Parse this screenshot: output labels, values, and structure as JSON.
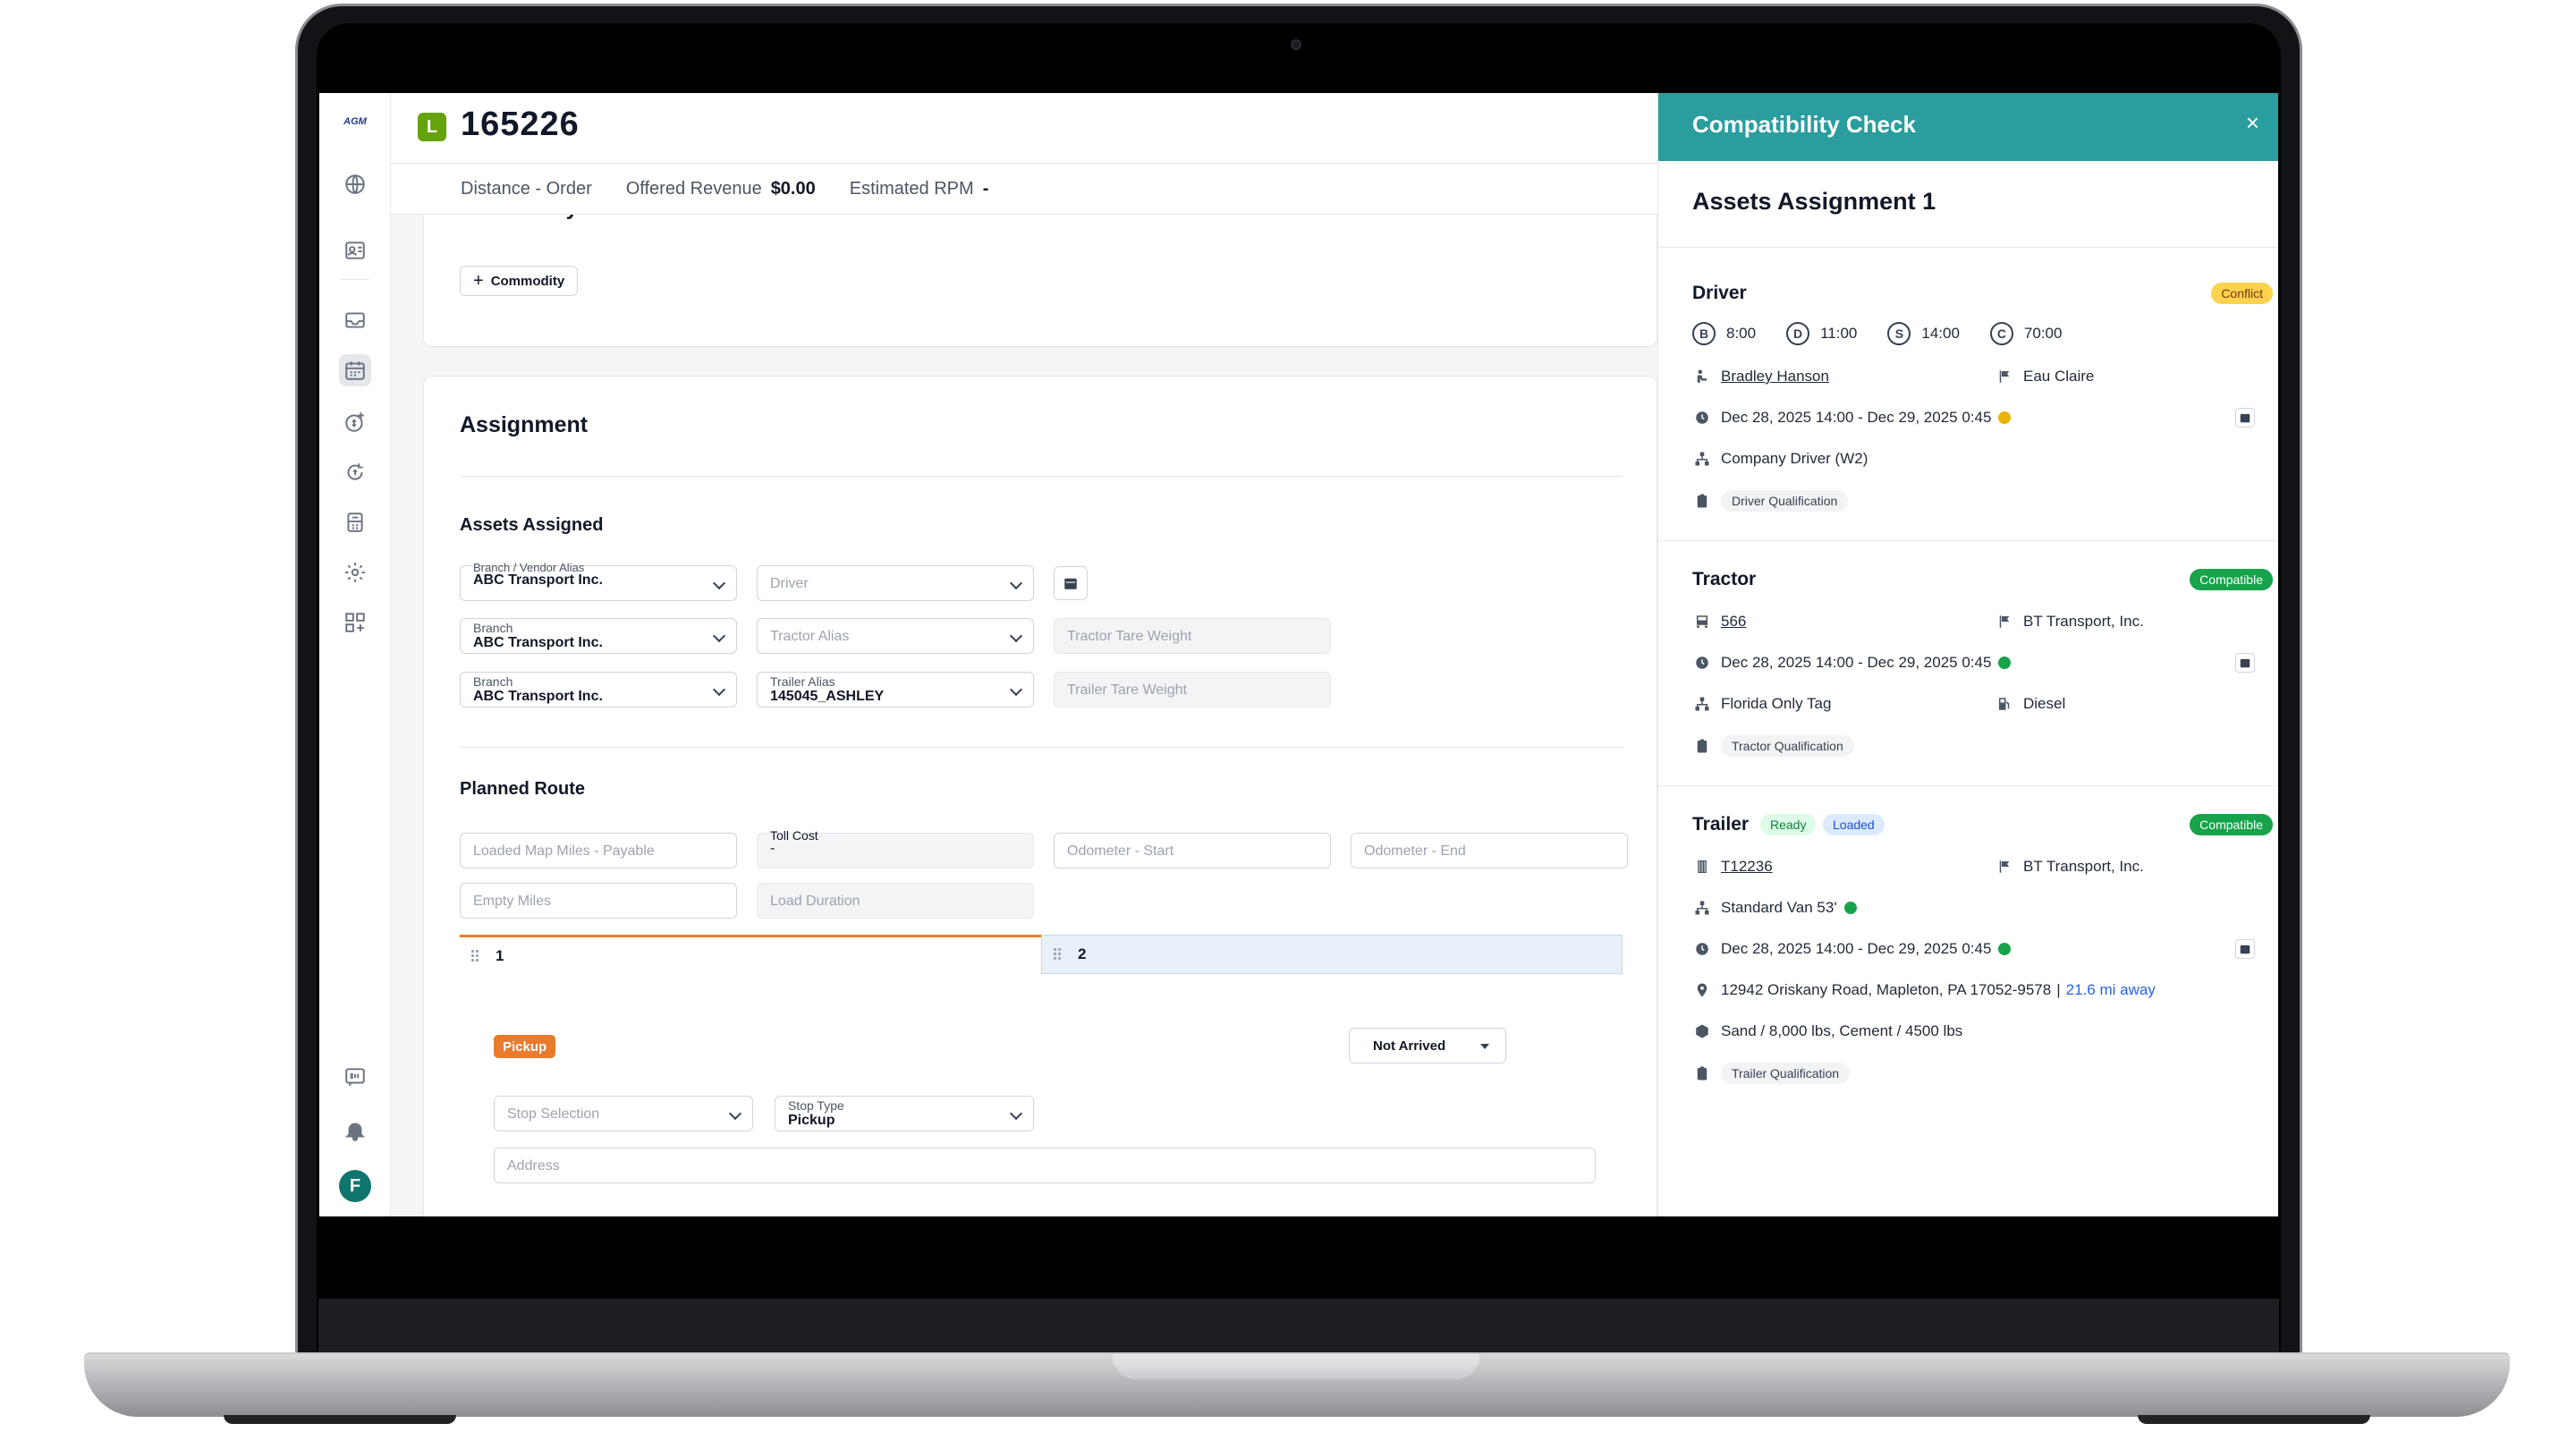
{
  "header": {
    "badge": "L",
    "load_number": "165226",
    "distance_label": "Distance",
    "distance_value": "-",
    "distance_mode": "Order",
    "offered_revenue_label": "Offered Revenue",
    "offered_revenue_value": "$0.00",
    "estimated_rpm_label": "Estimated RPM",
    "estimated_rpm_value": "-"
  },
  "sidebar": {
    "logo": "AGM",
    "avatar": "F",
    "items": [
      "globe-icon",
      "contacts-icon",
      "inbox-icon",
      "calendar-icon",
      "dollar-plus-icon",
      "dollar-refresh-icon",
      "calculator-icon",
      "gear-icon",
      "grid-plus-icon",
      "edi-icon",
      "bell-icon"
    ]
  },
  "commodity": {
    "title": "Commodity List",
    "add_button": "Commodity"
  },
  "assignment": {
    "title": "Assignment",
    "assets_title": "Assets Assigned",
    "row1": {
      "branch_label": "Branch / Vendor Alias",
      "branch_value": "ABC Transport Inc.",
      "driver_placeholder": "Driver"
    },
    "row2": {
      "branch_label": "Branch",
      "branch_value": "ABC Transport Inc.",
      "tractor_placeholder": "Tractor Alias",
      "tare_placeholder": "Tractor Tare Weight"
    },
    "row3": {
      "branch_label": "Branch",
      "branch_value": "ABC Transport Inc.",
      "trailer_label": "Trailer Alias",
      "trailer_value": "145045_ASHLEY",
      "tare_placeholder": "Trailer Tare Weight"
    },
    "route_title": "Planned Route",
    "loaded_miles": "Loaded Map Miles - Payable",
    "toll_label": "Toll Cost",
    "toll_value": "-",
    "odo_start": "Odometer - Start",
    "odo_end": "Odometer - End",
    "empty_miles": "Empty Miles",
    "load_duration": "Load Duration",
    "stop_tabs": [
      "1",
      "2"
    ],
    "pickup_badge": "Pickup",
    "status_select": "Not Arrived",
    "stop_selection": "Stop Selection",
    "stop_type_label": "Stop Type",
    "stop_type_value": "Pickup",
    "address": "Address"
  },
  "panel": {
    "title": "Compatibility Check",
    "close": "×",
    "subtitle": "Assets Assignment 1",
    "driver": {
      "title": "Driver",
      "status": "Conflict",
      "hos": [
        {
          "code": "B",
          "value": "8:00"
        },
        {
          "code": "D",
          "value": "11:00"
        },
        {
          "code": "S",
          "value": "14:00"
        },
        {
          "code": "C",
          "value": "70:00"
        }
      ],
      "name": "Bradley Hanson",
      "location": "Eau Claire",
      "window": "Dec 28, 2025 14:00 - Dec 29, 2025 0:45",
      "type": "Company Driver (W2)",
      "qualification": "Driver Qualification"
    },
    "tractor": {
      "title": "Tractor",
      "status": "Compatible",
      "unit": "566",
      "carrier": "BT Transport, Inc.",
      "window": "Dec 28, 2025 14:00 - Dec 29, 2025 0:45",
      "tag": "Florida Only Tag",
      "fuel": "Diesel",
      "qualification": "Tractor Qualification"
    },
    "trailer": {
      "title": "Trailer",
      "badge_ready": "Ready",
      "badge_loaded": "Loaded",
      "status": "Compatible",
      "unit": "T12236",
      "carrier": "BT Transport, Inc.",
      "equipment": "Standard Van 53'",
      "window": "Dec 28, 2025 14:00 - Dec 29, 2025 0:45",
      "address": "12942 Oriskany Road, Mapleton, PA 17052-9578",
      "separator": "|",
      "distance_away": "21.6 mi away",
      "load": "Sand / 8,000 lbs, Cement / 4500 lbs",
      "qualification": "Trailer Qualification"
    }
  },
  "colors": {
    "panel_header": "#2a9d9f",
    "load_badge": "#65a30d",
    "pickup": "#ea7a2c",
    "conflict": "#fcd34d",
    "compatible": "#16a34a"
  }
}
